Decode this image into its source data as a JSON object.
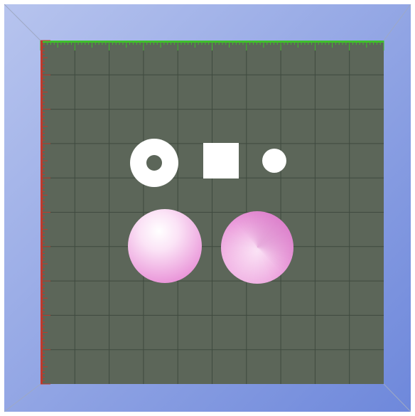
{
  "window": {
    "title": ""
  },
  "scene": {
    "view": "top",
    "colors": {
      "background_light": "#b7c4ee",
      "background_dark": "#6e88db",
      "frame_edge": "#9ea9c4",
      "bed": "#5c6659",
      "grid_line": "#3f4a3f",
      "x_ruler": "#3fbf2b",
      "y_ruler": "#c0392b",
      "white_part": "#ffffff",
      "pink_part_light": "#fbe3f6",
      "pink_part": "#e88ed6",
      "pink_part_dark": "#c65bb5"
    },
    "grid": {
      "columns": 10,
      "rows": 10
    },
    "objects": [
      {
        "name": "ring",
        "shape": "washer",
        "color": "white"
      },
      {
        "name": "square",
        "shape": "square",
        "color": "white"
      },
      {
        "name": "small-circle",
        "shape": "disc",
        "color": "white"
      },
      {
        "name": "sphere",
        "shape": "sphere",
        "color": "pink"
      },
      {
        "name": "cone",
        "shape": "cone",
        "color": "pink"
      }
    ]
  }
}
